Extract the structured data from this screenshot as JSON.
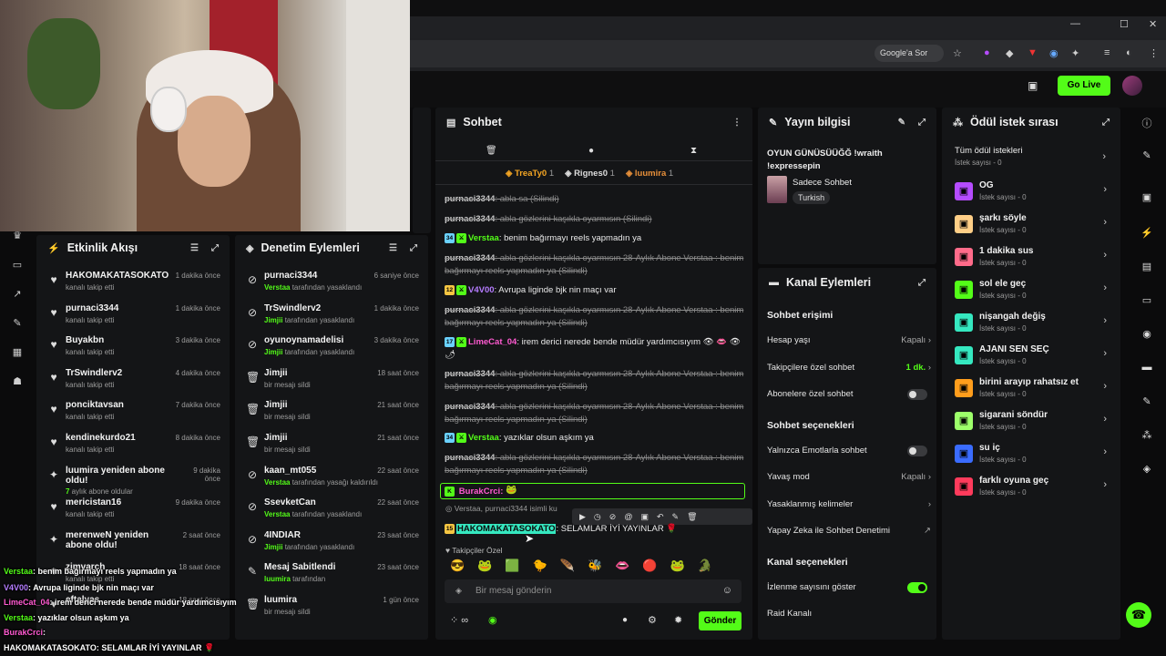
{
  "browser": {
    "google_button": "Google'a Sor",
    "window_controls": [
      "—",
      "☐",
      "✕"
    ]
  },
  "header": {
    "go_live": "Go Live"
  },
  "activity": {
    "title": "Etkinlik Akışı",
    "events": [
      {
        "name": "HAKOMAKATASOKATO",
        "sub": "kanalı takip etti",
        "time": "1 dakika önce",
        "icon": "heart-icon"
      },
      {
        "name": "purnaci3344",
        "sub": "kanalı takip etti",
        "time": "1 dakika önce",
        "icon": "heart-icon"
      },
      {
        "name": "Buyakbn",
        "sub": "kanalı takip etti",
        "time": "3 dakika önce",
        "icon": "heart-icon"
      },
      {
        "name": "TrSwindlerv2",
        "sub": "kanalı takip etti",
        "time": "4 dakika önce",
        "icon": "heart-icon"
      },
      {
        "name": "ponciktavsan",
        "sub": "kanalı takip etti",
        "time": "7 dakika önce",
        "icon": "heart-icon"
      },
      {
        "name": "kendinekurdo21",
        "sub": "kanalı takip etti",
        "time": "8 dakika önce",
        "icon": "heart-icon"
      },
      {
        "name": "luumira yeniden abone oldu!",
        "sub_strong": "7",
        "sub": "aylık abone oldular",
        "time": "9 dakika önce",
        "icon": "star-icon"
      },
      {
        "name": "mericistan16",
        "sub": "kanalı takip etti",
        "time": "9 dakika önce",
        "icon": "heart-icon"
      },
      {
        "name": "merenweN yeniden abone oldu!",
        "sub": "",
        "time": "2 saat önce",
        "icon": "star-icon"
      },
      {
        "name": "zimvarch",
        "sub": "kanalı takip etti",
        "time": "18 saat önce",
        "icon": "heart-icon"
      },
      {
        "name": "eftalyas",
        "sub": "",
        "time": "18 saat önce",
        "icon": "heart-icon"
      }
    ]
  },
  "moderation": {
    "title": "Denetim Eylemleri",
    "events": [
      {
        "name": "purnaci3344",
        "by": "Verstaa",
        "sub": "tarafından yasaklandı",
        "time": "6 saniye önce",
        "icon": "ban-icon"
      },
      {
        "name": "TrSwindlerv2",
        "by": "Jimjii",
        "sub": "tarafından yasaklandı",
        "time": "1 dakika önce",
        "icon": "ban-icon"
      },
      {
        "name": "oyunoynamadelisi",
        "by": "Jimjii",
        "sub": "tarafından yasaklandı",
        "time": "3 dakika önce",
        "icon": "ban-icon"
      },
      {
        "name": "Jimjii",
        "by": "",
        "sub": "bir mesajı sildi",
        "time": "18 saat önce",
        "icon": "trash-icon"
      },
      {
        "name": "Jimjii",
        "by": "",
        "sub": "bir mesajı sildi",
        "time": "21 saat önce",
        "icon": "trash-icon"
      },
      {
        "name": "Jimjii",
        "by": "",
        "sub": "bir mesajı sildi",
        "time": "21 saat önce",
        "icon": "trash-icon"
      },
      {
        "name": "kaan_mt055",
        "by": "Verstaa",
        "sub": "tarafından yasağı kaldırıldı",
        "time": "22 saat önce",
        "icon": "ban-icon"
      },
      {
        "name": "SsevketCan",
        "by": "Verstaa",
        "sub": "tarafından yasaklandı",
        "time": "22 saat önce",
        "icon": "ban-icon"
      },
      {
        "name": "4INDIAR",
        "by": "Jimjii",
        "sub": "tarafından yasaklandı",
        "time": "23 saat önce",
        "icon": "ban-icon"
      },
      {
        "name": "Mesaj Sabitlendi",
        "by": "luumira",
        "sub": "tarafından",
        "time": "23 saat önce",
        "icon": "pin-icon"
      },
      {
        "name": "luumira",
        "by": "",
        "sub": "bir mesajı sildi",
        "time": "1 gün önce",
        "icon": "trash-icon"
      }
    ]
  },
  "chat": {
    "title": "Sohbet",
    "top_gifters": [
      {
        "name": "TreaTy0",
        "count": "1",
        "color": "#f5a623"
      },
      {
        "name": "Rignes0",
        "count": "1",
        "color": "#dddddd"
      },
      {
        "name": "luumira",
        "count": "1",
        "color": "#e8903a"
      }
    ],
    "messages": [
      {
        "user": "purnaci3344",
        "text": ": abla sa (Silindi)",
        "deleted": true,
        "color": "#cfcfcf"
      },
      {
        "user": "purnaci3344",
        "text": ": abla gözlerini kaşıkla oyarmısın (Silindi)",
        "deleted": true,
        "color": "#cfcfcf"
      },
      {
        "user": "Verstaa",
        "text": ": benim bağırmayı reels yapmadın ya",
        "deleted": false,
        "color": "#53fc18",
        "badge": "34"
      },
      {
        "user": "purnaci3344",
        "text": ": abla gözlerini kaşıkla oyarmısın 28-Aylık Abone Verstaa : benim bağırmayı reels yapmadın ya (Silindi)",
        "deleted": true,
        "color": "#cfcfcf"
      },
      {
        "user": "V4V00",
        "text": ": Avrupa liginde bjk nin maçı var",
        "deleted": false,
        "color": "#b57cff",
        "badge": "12"
      },
      {
        "user": "purnaci3344",
        "text": ": abla gözlerini kaşıkla oyarmısın 28-Aylık Abone Verstaa : benim bağırmayı reels yapmadın ya (Silindi)",
        "deleted": true,
        "color": "#cfcfcf"
      },
      {
        "user": "LimeCat_04",
        "text": ": irem derici nerede bende müdür yardımcısıyım 👁 👄 👁 🌶",
        "deleted": false,
        "color": "#ff5ad1",
        "badge": "17"
      },
      {
        "user": "purnaci3344",
        "text": ": abla gözlerini kaşıkla oyarmısın 28-Aylık Abone Verstaa : benim bağırmayı reels yapmadın ya (Silindi)",
        "deleted": true,
        "color": "#cfcfcf"
      },
      {
        "user": "purnaci3344",
        "text": ": abla gözlerini kaşıkla oyarmısın 28-Aylık Abone Verstaa : benim bağırmayı reels yapmadın ya (Silindi)",
        "deleted": true,
        "color": "#cfcfcf"
      },
      {
        "user": "Verstaa",
        "text": ": yazıklar olsun aşkım ya",
        "deleted": false,
        "color": "#53fc18",
        "badge": "34"
      },
      {
        "user": "purnaci3344",
        "text": ": abla gözlerini kaşıkla oyarmısın 28-Aylık Abone Verstaa : benim bağırmayı reels yapmadın ya (Silindi)",
        "deleted": true,
        "color": "#cfcfcf"
      }
    ],
    "pinned_user": "BurakCrci:",
    "reply_hint": "Verstaa, purnaci3344 isimli ku",
    "last_user": "HAKOMAKATASOKATO",
    "last_text": ": SELAMLAR İYİ YAYINLAR 🌹",
    "emote_section": "Takipçiler Özel",
    "input_placeholder": "Bir mesaj gönderin",
    "send": "Gönder"
  },
  "stream_info": {
    "title": "Yayın bilgisi",
    "stream_title": "OYUN GÜNÜSÜÜĞĞ !wraith !expressepin",
    "category": "Sadece Sohbet",
    "tag": "Turkish"
  },
  "channel_actions": {
    "title": "Kanal Eylemleri",
    "chat_access": "Sohbet erişimi",
    "age_label": "Hesap yaşı",
    "age_value": "Kapalı",
    "followers_only": "Takipçilere özel sohbet",
    "followers_value": "1 dk.",
    "subs_only": "Abonelere özel sohbet",
    "chat_options": "Sohbet seçenekleri",
    "emotes_only": "Yalnızca Emotlarla sohbet",
    "slow_mode": "Yavaş mod",
    "slow_value": "Kapalı",
    "banned_words": "Yasaklanmış kelimeler",
    "ai_moderation": "Yapay Zeka ile Sohbet Denetimi",
    "channel_options": "Kanal seçenekleri",
    "viewer_count": "İzlenme sayısını göster",
    "raid": "Raid Kanalı"
  },
  "rewards": {
    "title": "Ödül istek sırası",
    "all": "Tüm ödül istekleri",
    "all_sub": "İstek sayısı - 0",
    "items": [
      {
        "name": "OG",
        "sub": "İstek sayısı - 0",
        "color": "#b54cff"
      },
      {
        "name": "şarkı söyle",
        "sub": "İstek sayısı - 0",
        "color": "#ffcf87"
      },
      {
        "name": "1 dakika sus",
        "sub": "İstek sayısı - 0",
        "color": "#ff6b8a"
      },
      {
        "name": "sol ele geç",
        "sub": "İstek sayısı - 0",
        "color": "#53fc18"
      },
      {
        "name": "nişangah değiş",
        "sub": "İstek sayısı - 0",
        "color": "#35e8c0"
      },
      {
        "name": "AJANI SEN SEÇ",
        "sub": "İstek sayısı - 0",
        "color": "#35e8c0"
      },
      {
        "name": "birini arayıp rahatsız et",
        "sub": "İstek sayısı - 0",
        "color": "#ff9d1c"
      },
      {
        "name": "sigarani söndür",
        "sub": "İstek sayısı - 0",
        "color": "#9dff6a"
      },
      {
        "name": "su iç",
        "sub": "İstek sayısı - 0",
        "color": "#3a6cff"
      },
      {
        "name": "farklı oyuna geç",
        "sub": "İstek sayısı - 0",
        "color": "#ff3b5c"
      }
    ]
  },
  "overlay_chat": [
    {
      "user": "Verstaa",
      "text": ": benim bağırmayı reels yapmadın ya",
      "color": "#53fc18"
    },
    {
      "user": "V4V00",
      "text": ": Avrupa liginde bjk nin maçı var",
      "color": "#b57cff"
    },
    {
      "user": "LimeCat_04",
      "text": ": irem derici nerede bende müdür yardımcısıyım",
      "color": "#ff5ad1"
    },
    {
      "user": "Verstaa",
      "text": ": yazıklar olsun aşkım ya",
      "color": "#53fc18"
    },
    {
      "user": "BurakCrci",
      "text": ":",
      "color": "#ff5ad1"
    },
    {
      "user": "HAKOMAKATASOKATO",
      "text": ": SELAMLAR İYİ YAYINLAR 🌹",
      "color": "#ffffff"
    }
  ]
}
